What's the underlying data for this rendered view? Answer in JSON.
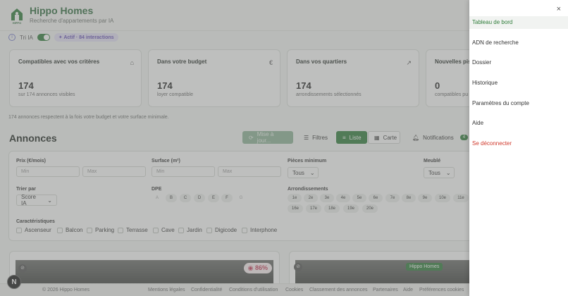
{
  "brand": {
    "title": "Hippo Homes",
    "subtitle": "Recherche d'appartements par IA",
    "logo_text": "HIPPO"
  },
  "ai": {
    "label": "Tri IA",
    "badge": "✦ Actif · 84 interactions"
  },
  "cards": [
    {
      "title": "Compatibles avec vos critères",
      "icon": "⌂",
      "value": "174",
      "note": "sur 174 annonces visibles"
    },
    {
      "title": "Dans votre budget",
      "icon": "€",
      "value": "174",
      "note": "loyer compatible"
    },
    {
      "title": "Dans vos quartiers",
      "icon": "↗",
      "value": "174",
      "note": "arrondissements sélectionnés"
    },
    {
      "title": "Nouvelles pis",
      "icon": "",
      "value": "0",
      "note": "compatibles pu"
    }
  ],
  "summary": "174 annonces respectent à la fois votre budget et votre surface minimale.",
  "annonces": {
    "title": "Annonces",
    "update_label": "Mise à jour...",
    "filters_label": "Filtres",
    "list_label": "Liste",
    "map_label": "Carte",
    "notifications_label": "Notifications",
    "notifications_count": "4"
  },
  "filters": {
    "price_label": "Prix (€/mois)",
    "surface_label": "Surface (m²)",
    "min_placeholder": "Min",
    "max_placeholder": "Max",
    "rooms_label": "Pièces minimum",
    "rooms_value": "Tous",
    "furnished_label": "Meublé",
    "furnished_value": "Tous",
    "sort_label": "Trier par",
    "sort_value": "Score IA",
    "dpe_label": "DPE",
    "dpe": [
      "A",
      "B",
      "C",
      "D",
      "E",
      "F",
      "G"
    ],
    "arr_label": "Arrondissements",
    "arrondissements": [
      "1e",
      "2e",
      "3e",
      "4e",
      "5e",
      "6e",
      "7e",
      "8e",
      "9e",
      "10e",
      "11e",
      "16e",
      "17e",
      "18e",
      "19e",
      "20e"
    ],
    "features_label": "Caractéristiques",
    "features": [
      "Ascenseur",
      "Balcon",
      "Parking",
      "Terrasse",
      "Cave",
      "Jardin",
      "Digicode",
      "Interphone"
    ]
  },
  "listings": {
    "score": "86%",
    "tag": "Hippo Homes"
  },
  "footer": {
    "copyright": "© 2026 Hippo Homes",
    "links": [
      "Mentions légales",
      "Confidentialité",
      "Conditions d'utilisation",
      "Cookies",
      "Classement des annonces",
      "Partenaires",
      "Aide",
      "Préférences cookies"
    ]
  },
  "avatar": "N",
  "drawer": {
    "close": "×",
    "items": [
      "Tableau de bord",
      "ADN de recherche",
      "Dossier",
      "Historique",
      "Paramètres du compte",
      "Aide"
    ],
    "logout": "Se déconnecter"
  }
}
